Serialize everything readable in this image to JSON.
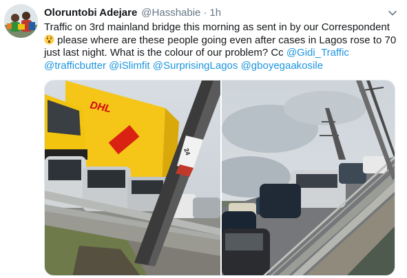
{
  "tweet": {
    "author_name": "Oloruntobi Adejare",
    "handle": "@Hasshabie",
    "separator": "·",
    "time": "1h",
    "text_line1": "Traffic on 3rd mainland bridge this morning as sent in by our Correspondent",
    "text_line2_rest": " please where are these people going even after cases in Lagos rose to 70",
    "text_line3": "just last night. What is the colour of our problem? Cc ",
    "mentions": [
      "@Gidi_Traffic",
      "@trafficbutter",
      "@iSlimfit",
      "@SurprisingLagos",
      "@gboyegaakosile"
    ],
    "emoji": "hushed-face-emoji"
  },
  "photos": {
    "left": {
      "truck_brand": "DHL",
      "pole_sign": "24"
    },
    "right": {}
  },
  "colors": {
    "link": "#1b95e0",
    "secondary_text": "#657786",
    "dhl_yellow": "#f5c518",
    "dhl_red": "#d40511"
  }
}
